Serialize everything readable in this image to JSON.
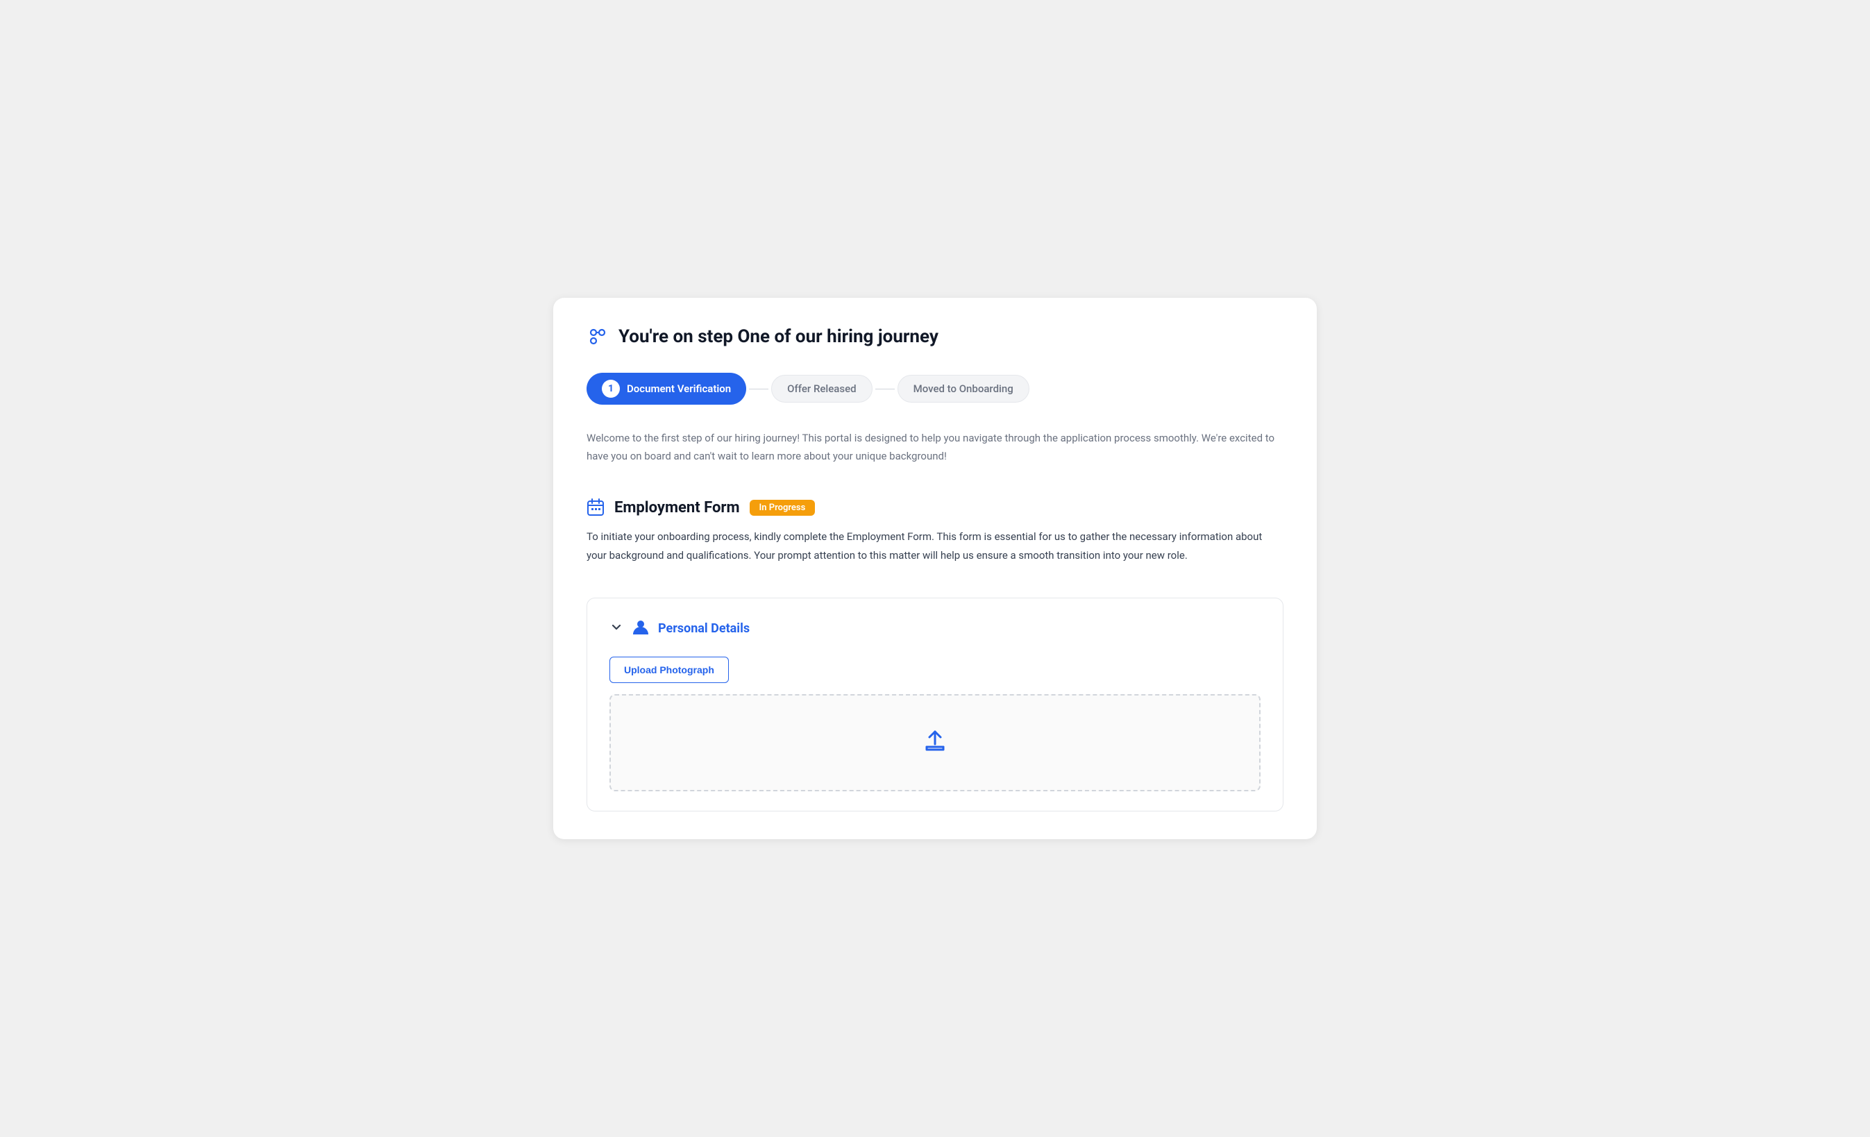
{
  "page": {
    "header_icon": "🔗",
    "title": "You're on step One of our hiring journey",
    "welcome_text": "Welcome to the first step of our hiring journey! This portal is designed to help you navigate through the application process smoothly. We're excited to have you on board and can't wait to learn more about your unique background!"
  },
  "steps": [
    {
      "id": 1,
      "label": "Document Verification",
      "status": "active",
      "number": "1"
    },
    {
      "id": 2,
      "label": "Offer Released",
      "status": "inactive"
    },
    {
      "id": 3,
      "label": "Moved to Onboarding",
      "status": "inactive"
    }
  ],
  "employment_form": {
    "title": "Employment Form",
    "badge": "In Progress",
    "description": "To initiate your onboarding process, kindly complete the Employment Form. This form is essential for us to gather the necessary information about your background and qualifications. Your prompt attention to this matter will help us ensure a smooth transition into your new role."
  },
  "personal_details": {
    "title": "Personal Details",
    "upload_button_label": "Upload Photograph"
  },
  "colors": {
    "primary": "#2563eb",
    "badge_in_progress": "#f59e0b",
    "text_muted": "#6b7280",
    "text_dark": "#111827",
    "border": "#e5e7eb"
  }
}
